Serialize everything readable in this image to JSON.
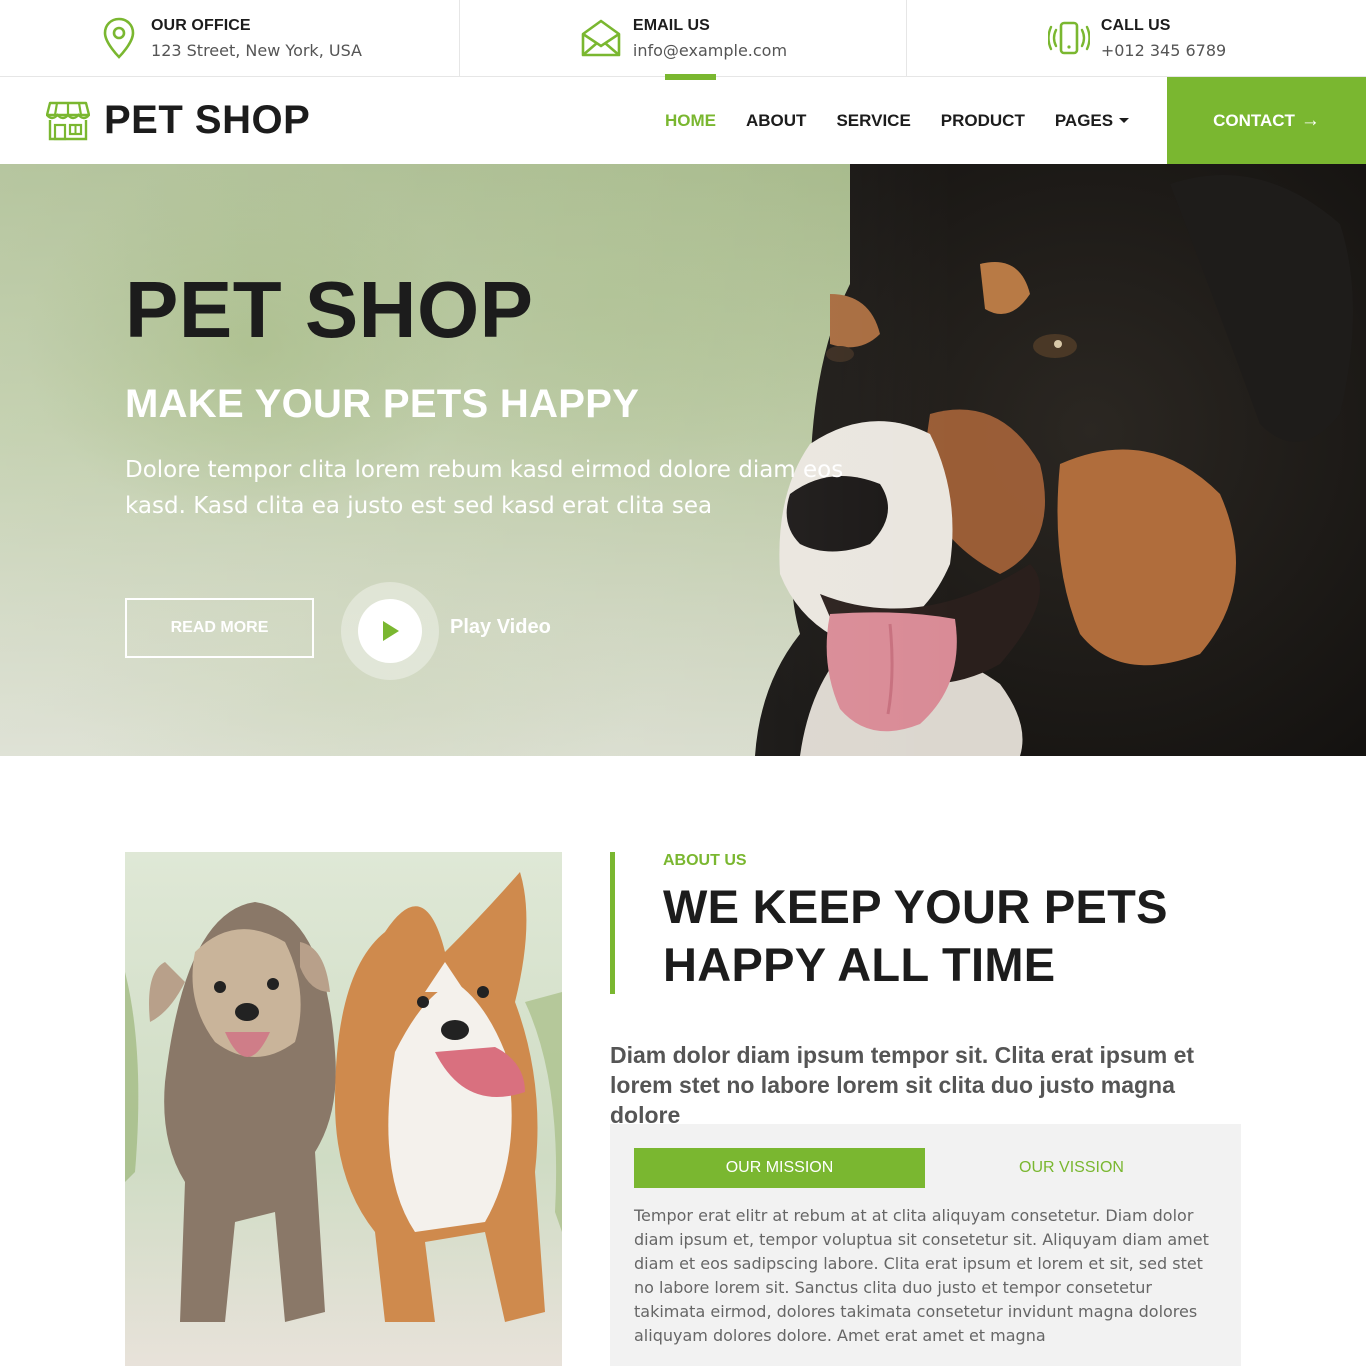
{
  "topbar": {
    "office": {
      "title": "OUR OFFICE",
      "value": "123 Street, New York, USA",
      "icon": "map-pin-icon"
    },
    "email": {
      "title": "EMAIL US",
      "value": "info@example.com",
      "icon": "envelope-icon"
    },
    "call": {
      "title": "CALL US",
      "value": "+012 345 6789",
      "icon": "phone-vibrate-icon"
    }
  },
  "navbar": {
    "brand": "PET SHOP",
    "brand_icon": "shop-icon",
    "links": [
      "HOME",
      "ABOUT",
      "SERVICE",
      "PRODUCT",
      "PAGES"
    ],
    "active": "HOME",
    "contact": "CONTACT",
    "contact_arrow": "→"
  },
  "hero": {
    "title": "PET SHOP",
    "subtitle": "MAKE YOUR PETS HAPPY",
    "description": "Dolore tempor clita lorem rebum kasd eirmod dolore diam eos kasd. Kasd clita ea justo est sed kasd erat clita sea",
    "read_more": "READ MORE",
    "play_label": "Play Video"
  },
  "about": {
    "kicker": "ABOUT US",
    "title": "WE KEEP YOUR PETS HAPPY ALL TIME",
    "lead": "Diam dolor diam ipsum tempor sit. Clita erat ipsum et lorem stet no labore lorem sit clita duo justo magna dolore",
    "tabs": [
      "OUR MISSION",
      "OUR VISSION"
    ],
    "active_tab": "OUR MISSION",
    "tab_text": "Tempor erat elitr at rebum at at clita aliquyam consetetur. Diam dolor diam ipsum et, tempor voluptua sit consetetur sit. Aliquyam diam amet diam et eos sadipscing labore. Clita erat ipsum et lorem et sit, sed stet no labore lorem sit. Sanctus clita duo justo et tempor consetetur takimata eirmod, dolores takimata consetetur invidunt magna dolores aliquyam dolores dolore. Amet erat amet et magna"
  },
  "colors": {
    "accent": "#7ab730",
    "dark": "#1c1c1c",
    "muted": "#555555"
  }
}
